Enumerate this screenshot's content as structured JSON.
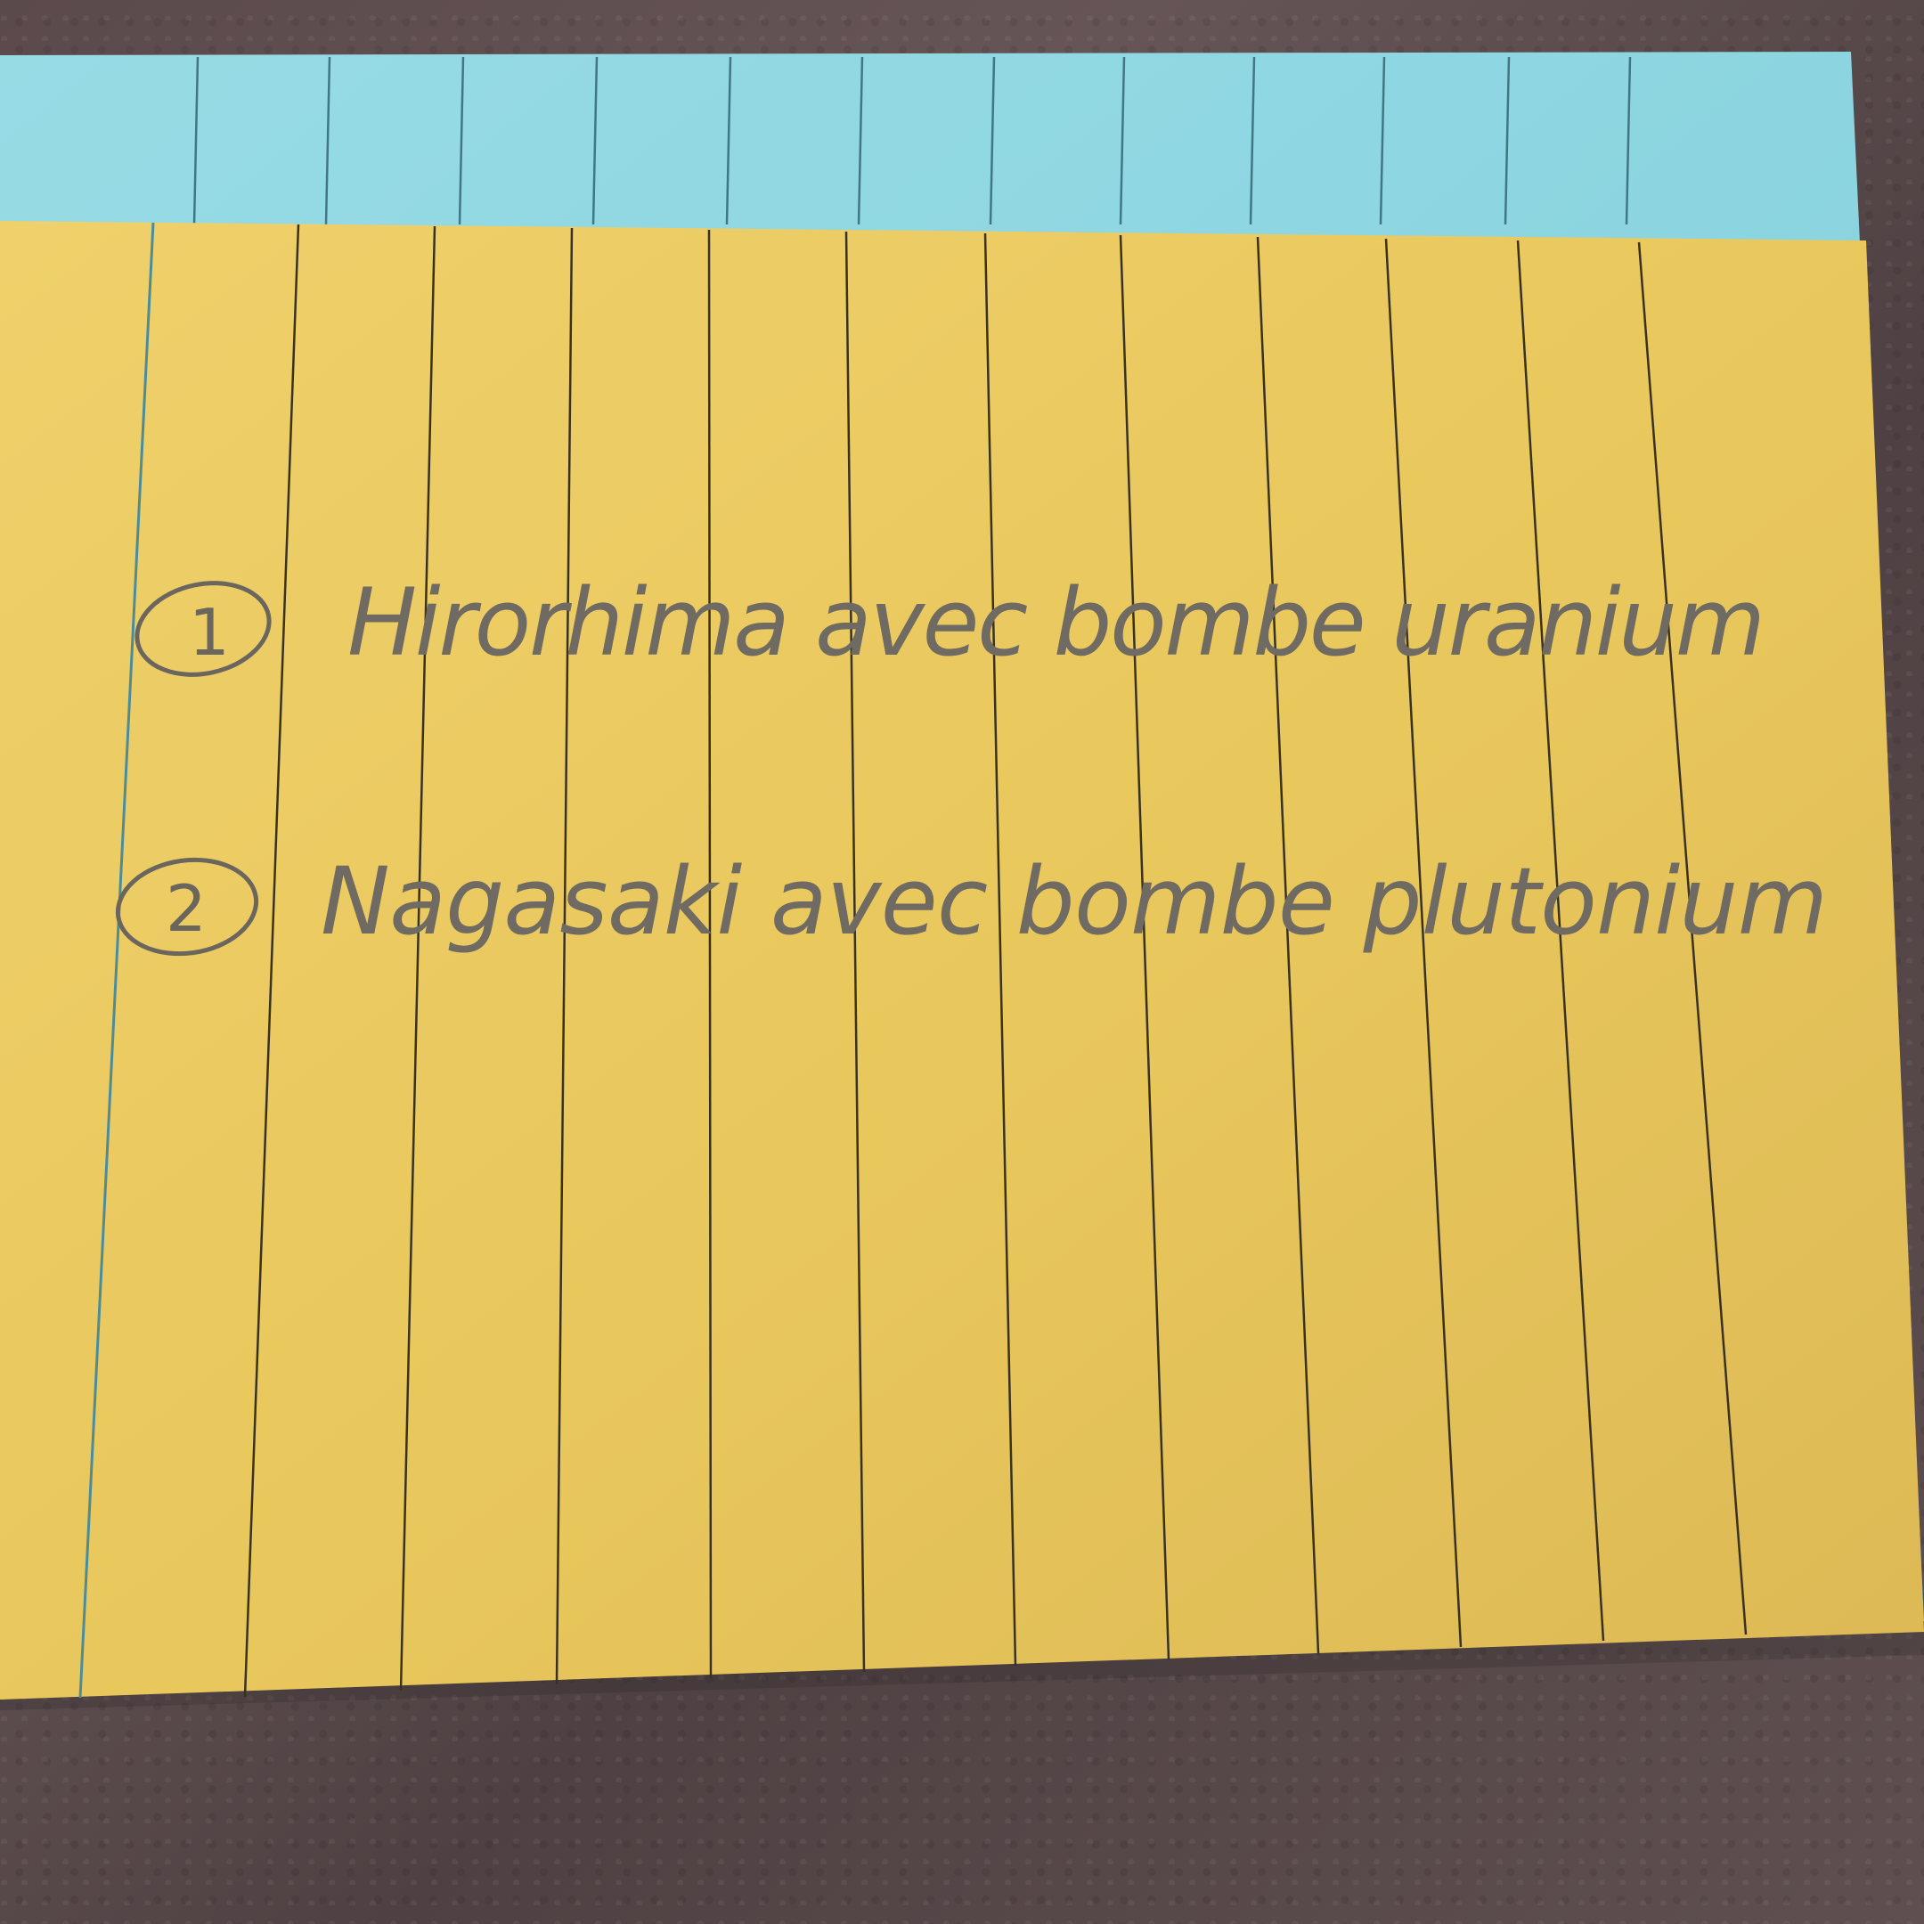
{
  "scene": {
    "description_free": true,
    "colors": {
      "table": "#5a4b4c",
      "back_card": "#8dd7e1",
      "front_card": "#eac95f",
      "ruling_front": "#2f2a1c",
      "ruling_back": "#4a7e8a",
      "ink": "#6f6a62"
    }
  },
  "note": {
    "lines": [
      {
        "number": "1",
        "text": "Hirorhima avec bombe uranium"
      },
      {
        "number": "2",
        "text": "Nagasaki avec bombe plutonium"
      }
    ]
  }
}
